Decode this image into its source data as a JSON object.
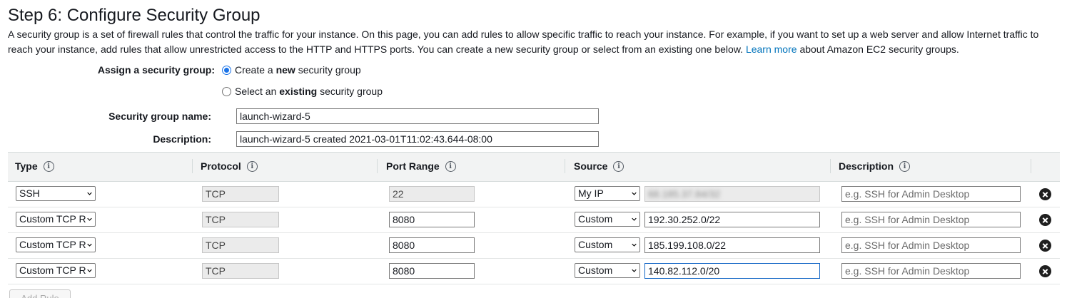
{
  "step": {
    "title": "Step 6: Configure Security Group",
    "intro_text": "A security group is a set of firewall rules that control the traffic for your instance. On this page, you can add rules to allow specific traffic to reach your instance. For example, if you want to set up a web server and allow Internet traffic to reach your instance, add rules that allow unrestricted access to the HTTP and HTTPS ports. You can create a new security group or select from an existing one below.",
    "learn_more_link": "Learn more",
    "intro_suffix": "about Amazon EC2 security groups."
  },
  "assign": {
    "label": "Assign a security group:",
    "option_new_prefix": "Create a",
    "option_new_bold": "new",
    "option_new_suffix": "security group",
    "option_existing_prefix": "Select an",
    "option_existing_bold": "existing",
    "option_existing_suffix": "security group",
    "selected": "new"
  },
  "form": {
    "name_label": "Security group name:",
    "name_value": "launch-wizard-5",
    "description_label": "Description:",
    "description_value": "launch-wizard-5 created 2021-03-01T11:02:43.644-08:00"
  },
  "table": {
    "headers": {
      "type": "Type",
      "protocol": "Protocol",
      "port_range": "Port Range",
      "source": "Source",
      "description": "Description"
    },
    "info_glyph": "i",
    "description_placeholder": "e.g. SSH for Admin Desktop",
    "rows": [
      {
        "type": "SSH",
        "protocol": "TCP",
        "port": "22",
        "source_type": "My IP",
        "source_value": "68.185.37.84/32",
        "port_disabled": true
      },
      {
        "type": "Custom TCP R",
        "protocol": "TCP",
        "port": "8080",
        "source_type": "Custom",
        "source_value": "192.30.252.0/22",
        "port_disabled": false
      },
      {
        "type": "Custom TCP R",
        "protocol": "TCP",
        "port": "8080",
        "source_type": "Custom",
        "source_value": "185.199.108.0/22",
        "port_disabled": false
      },
      {
        "type": "Custom TCP R",
        "protocol": "TCP",
        "port": "8080",
        "source_type": "Custom",
        "source_value": "140.82.112.0/20",
        "port_disabled": false
      }
    ]
  },
  "add_rule_label": "Add Rule",
  "colors": {
    "link": "#0073bb",
    "header_bg": "#f2f3f3",
    "radio_accent": "#1a73e8",
    "focus_border": "#1366c6"
  },
  "icons": [
    "info-icon",
    "chevron-down-icon",
    "remove-circle-icon"
  ]
}
